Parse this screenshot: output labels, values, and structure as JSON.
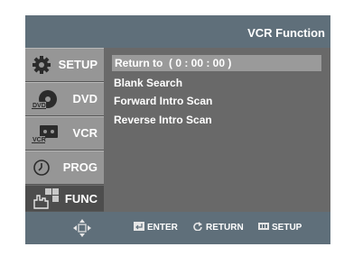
{
  "header": {
    "title": "VCR Function"
  },
  "sidebar": {
    "items": [
      {
        "label": "SETUP",
        "icon": "gear-icon",
        "active": false
      },
      {
        "label": "DVD",
        "icon": "dvd-disc-icon",
        "active": false
      },
      {
        "label": "VCR",
        "icon": "vcr-cassette-icon",
        "active": false
      },
      {
        "label": "PROG",
        "icon": "clock-icon",
        "active": false
      },
      {
        "label": "FUNC",
        "icon": "hand-pointer-icon",
        "active": true
      }
    ]
  },
  "menu": {
    "items": [
      "Return to  ( 0 : 00 : 00 )",
      "Blank Search",
      "Forward Intro Scan",
      "Reverse Intro Scan"
    ],
    "selected_index": 0
  },
  "footer": {
    "nav_icon": "dpad-arrows-icon",
    "enter_label": "ENTER",
    "return_label": "RETURN",
    "setup_label": "SETUP"
  },
  "colors": {
    "header_bg": "#5f6f7a",
    "content_bg": "#696969",
    "sidebar_bg": "#969696",
    "sidebar_active_bg": "#4d4d4d",
    "highlight_bg": "#9a9a9a",
    "text": "#ffffff"
  }
}
